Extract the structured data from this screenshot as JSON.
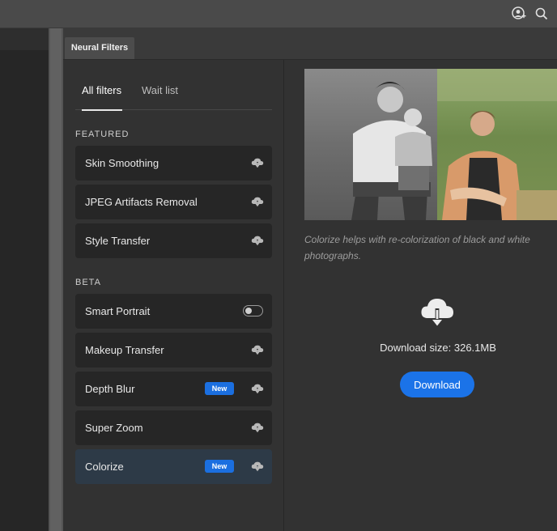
{
  "panel": {
    "title": "Neural Filters"
  },
  "tabs": {
    "all": "All filters",
    "wait": "Wait list"
  },
  "sections": {
    "featured": "FEATURED",
    "beta": "BETA"
  },
  "featured": [
    {
      "label": "Skin Smoothing",
      "icon": "cloud-download-icon"
    },
    {
      "label": "JPEG Artifacts Removal",
      "icon": "cloud-download-icon"
    },
    {
      "label": "Style Transfer",
      "icon": "cloud-download-icon"
    }
  ],
  "beta": [
    {
      "label": "Smart Portrait",
      "control": "toggle",
      "toggle_on": false
    },
    {
      "label": "Makeup Transfer",
      "icon": "cloud-download-icon"
    },
    {
      "label": "Depth Blur",
      "badge": "New",
      "icon": "cloud-download-icon"
    },
    {
      "label": "Super Zoom",
      "icon": "cloud-download-icon"
    },
    {
      "label": "Colorize",
      "badge": "New",
      "icon": "cloud-download-icon",
      "selected": true
    }
  ],
  "detail": {
    "description": "Colorize helps with re-colorization of black and white photographs.",
    "download_size": "Download size: 326.1MB",
    "download_button": "Download"
  },
  "colors": {
    "accent": "#1b73e8",
    "badge": "#1b6fe0",
    "selected_item": "#2d3a47"
  }
}
